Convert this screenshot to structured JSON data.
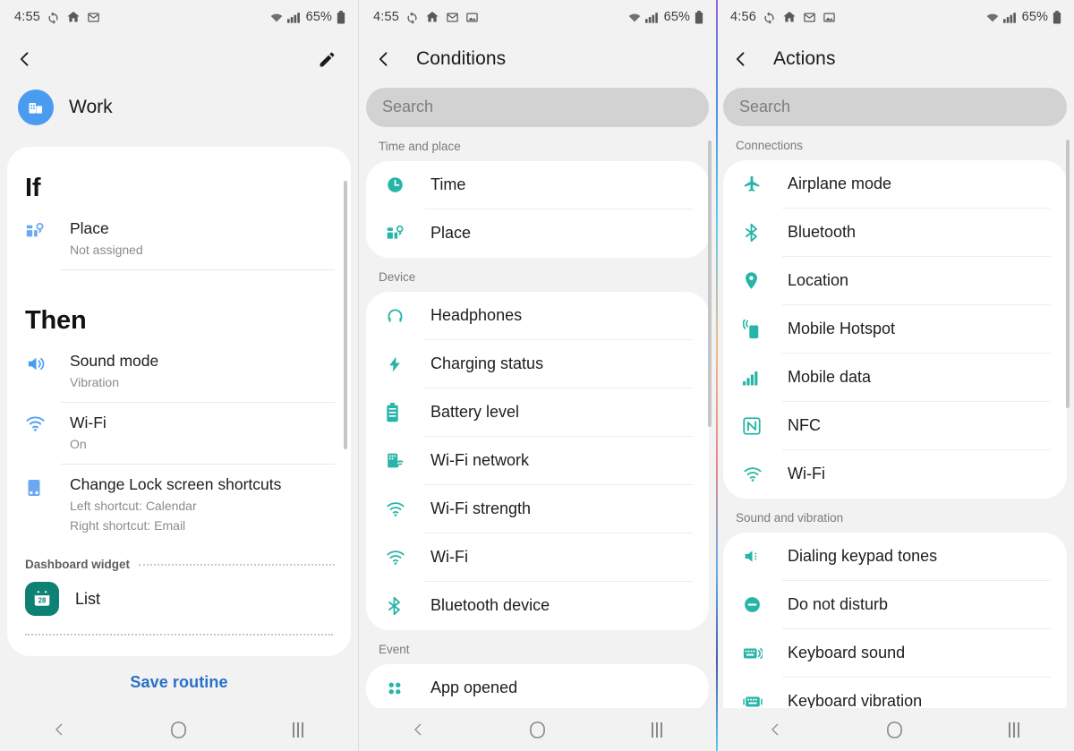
{
  "accent": {
    "blue": "#4a9cf0",
    "teal": "#26b5a6",
    "link": "#2a6fc9",
    "green": "#0e8074"
  },
  "phone1": {
    "statusbar": {
      "time": "4:55",
      "battery": "65%",
      "icons": [
        "sync-icon",
        "home-icon",
        "mail-icon"
      ]
    },
    "appbar": {
      "back": "back-icon",
      "edit": "edit-icon"
    },
    "routine": {
      "name": "Work",
      "avatar_icon": "building-icon"
    },
    "if": {
      "heading": "If",
      "items": [
        {
          "icon": "place-icon",
          "title": "Place",
          "subtitle": "Not assigned"
        }
      ]
    },
    "then": {
      "heading": "Then",
      "items": [
        {
          "icon": "sound-mode-icon",
          "title": "Sound mode",
          "subtitle": "Vibration"
        },
        {
          "icon": "wifi-icon",
          "title": "Wi-Fi",
          "subtitle": "On"
        },
        {
          "icon": "lockscreen-icon",
          "title": "Change Lock screen shortcuts",
          "subtitle": "Left shortcut: Calendar",
          "subtitle2": "Right shortcut: Email"
        }
      ]
    },
    "dashboard": {
      "label": "Dashboard widget",
      "widget_label": "List",
      "widget_icon": "calendar-28-icon"
    },
    "save_label": "Save routine"
  },
  "phone2": {
    "statusbar": {
      "time": "4:55",
      "battery": "65%",
      "icons": [
        "sync-icon",
        "home-icon",
        "mail-icon",
        "image-icon"
      ]
    },
    "appbar": {
      "title": "Conditions",
      "back": "back-icon"
    },
    "search": {
      "placeholder": "Search"
    },
    "groups": [
      {
        "title": "Time and place",
        "items": [
          {
            "icon": "clock-icon",
            "label": "Time"
          },
          {
            "icon": "place-icon",
            "label": "Place"
          }
        ]
      },
      {
        "title": "Device",
        "items": [
          {
            "icon": "headphones-icon",
            "label": "Headphones"
          },
          {
            "icon": "charging-icon",
            "label": "Charging status"
          },
          {
            "icon": "battery-icon",
            "label": "Battery level"
          },
          {
            "icon": "wifi-network-icon",
            "label": "Wi-Fi network"
          },
          {
            "icon": "wifi-strength-icon",
            "label": "Wi-Fi strength"
          },
          {
            "icon": "wifi-icon",
            "label": "Wi-Fi"
          },
          {
            "icon": "bluetooth-icon",
            "label": "Bluetooth device"
          }
        ]
      },
      {
        "title": "Event",
        "items": [
          {
            "icon": "apps-icon",
            "label": "App opened"
          }
        ]
      }
    ]
  },
  "phone3": {
    "statusbar": {
      "time": "4:56",
      "battery": "65%",
      "icons": [
        "sync-icon",
        "home-icon",
        "mail-icon",
        "image-icon"
      ]
    },
    "appbar": {
      "title": "Actions",
      "back": "back-icon"
    },
    "search": {
      "placeholder": "Search"
    },
    "groups": [
      {
        "title": "Connections",
        "items": [
          {
            "icon": "airplane-icon",
            "label": "Airplane mode"
          },
          {
            "icon": "bluetooth-icon",
            "label": "Bluetooth"
          },
          {
            "icon": "location-icon",
            "label": "Location"
          },
          {
            "icon": "hotspot-icon",
            "label": "Mobile Hotspot"
          },
          {
            "icon": "signal-icon",
            "label": "Mobile data"
          },
          {
            "icon": "nfc-icon",
            "label": "NFC"
          },
          {
            "icon": "wifi-icon",
            "label": "Wi-Fi"
          }
        ]
      },
      {
        "title": "Sound and vibration",
        "items": [
          {
            "icon": "keypad-tones-icon",
            "label": "Dialing keypad tones"
          },
          {
            "icon": "dnd-icon",
            "label": "Do not disturb"
          },
          {
            "icon": "keyboard-sound-icon",
            "label": "Keyboard sound"
          },
          {
            "icon": "keyboard-vibration-icon",
            "label": "Keyboard vibration"
          }
        ]
      }
    ]
  },
  "navbar": {
    "back": "back-icon",
    "home": "home-circle-icon",
    "recents": "recents-icon"
  }
}
